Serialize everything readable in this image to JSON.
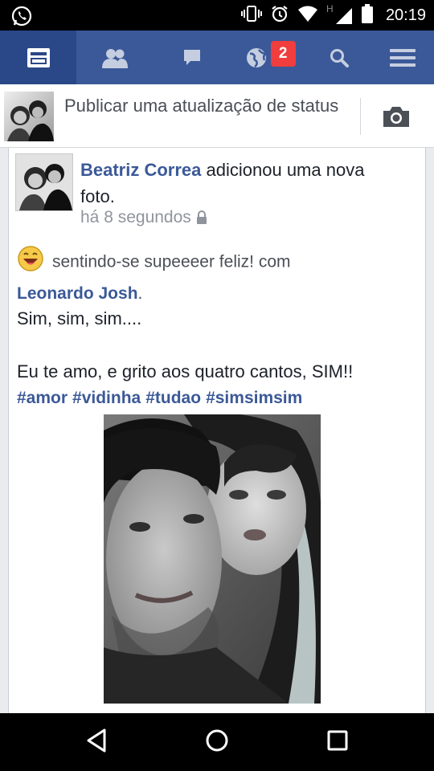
{
  "status_bar": {
    "time": "20:19",
    "network_label": "H"
  },
  "nav": {
    "notifications_count": "2"
  },
  "composer": {
    "prompt": "Publicar uma atualização de status"
  },
  "post": {
    "author": "Beatriz Correa",
    "action": "adicionou uma nova foto.",
    "timestamp": "há 8 segundos",
    "feeling_text": "sentindo-se supeeeer feliz! com",
    "tagged_person": "Leonardo Josh",
    "tagged_suffix": ".",
    "message_line1": "Sim, sim, sim....",
    "message_line2": "Eu te amo, e grito aos quatro cantos, SIM!!",
    "hashtags": [
      "#amor",
      "#vidinha",
      "#tudao",
      "#simsimsim"
    ]
  },
  "colors": {
    "brand": "#3b5998",
    "badge": "#f03d3d",
    "link": "#3b5998"
  }
}
